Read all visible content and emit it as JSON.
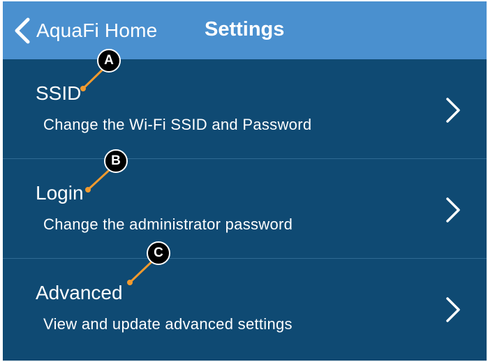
{
  "navbar": {
    "back_label": "AquaFi Home",
    "title": "Settings",
    "background": "#4a90cf"
  },
  "rows": [
    {
      "title": "SSID",
      "subtitle": "Change the Wi-Fi SSID and Password"
    },
    {
      "title": "Login",
      "subtitle": "Change the administrator password"
    },
    {
      "title": "Advanced",
      "subtitle": "View and update advanced settings"
    }
  ],
  "callouts": [
    "A",
    "B",
    "C"
  ],
  "colors": {
    "content_background": "#0f4a73",
    "callout_line": "#f29a2e",
    "text": "#ffffff"
  },
  "icons": {
    "back": "chevron-left-icon",
    "row_disclosure": "chevron-right-icon"
  }
}
